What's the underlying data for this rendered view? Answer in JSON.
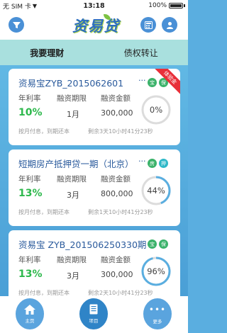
{
  "status_bar": {
    "carrier": "无 SIM 卡",
    "time": "13:18",
    "battery": "100%"
  },
  "header": {
    "logo": "资易贷",
    "filter_icon": "filter-icon",
    "calc_icon": "calculator-icon",
    "user_icon": "user-icon"
  },
  "tabs": [
    {
      "label": "我要理财",
      "active": true
    },
    {
      "label": "债权转让",
      "active": false
    }
  ],
  "columns": {
    "rate": "年利率",
    "term": "融资期限",
    "amount": "融资金额"
  },
  "cards": [
    {
      "title": "资易宝ZYB_2015062601",
      "dots": "···",
      "tags": [
        "宝",
        "保"
      ],
      "ribbon": "体验金",
      "rate": "10%",
      "term": "1月",
      "amount": "300,000",
      "progress_percent": 0,
      "progress_label": "0%",
      "repay": "按月付息，到期还本",
      "remaining": "剩余3天10小时41分23秒"
    },
    {
      "title": "短期房产抵押贷一期（北京）",
      "dots": "···",
      "tags": [
        "房",
        "押"
      ],
      "ribbon": "",
      "rate": "13%",
      "term": "3月",
      "amount": "800,000",
      "progress_percent": 44,
      "progress_label": "44%",
      "repay": "按月付息，到期还本",
      "remaining": "剩余1天10小时41分23秒"
    },
    {
      "title": "资易宝 ZYB_201506250330期",
      "dots": "",
      "tags": [
        "宝",
        "保"
      ],
      "ribbon": "",
      "rate": "13%",
      "term": "3月",
      "amount": "300,000",
      "progress_percent": 96,
      "progress_label": "96%",
      "repay": "按月付息，到期还本",
      "remaining": "剩余2天10小时41分23秒"
    }
  ],
  "bottom_nav": [
    {
      "label": "主页",
      "icon": "home-icon",
      "active": false
    },
    {
      "label": "项目",
      "icon": "document-icon",
      "active": true
    },
    {
      "label": "更多",
      "icon": "more-icon",
      "active": false
    }
  ],
  "colors": {
    "accent": "#4a90d6",
    "rate_green": "#2db84c",
    "ribbon_red": "#e8303a",
    "tab_bg": "#a9e0de"
  }
}
